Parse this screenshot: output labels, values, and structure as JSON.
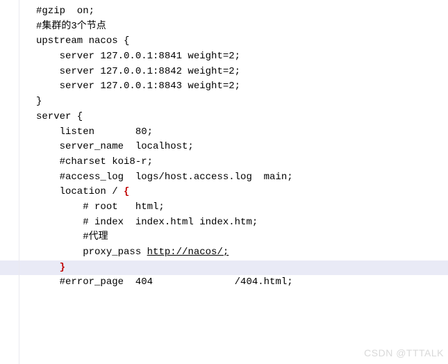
{
  "code": {
    "l1": "#gzip  on;",
    "l2": "",
    "l3": "#集群的3个节点",
    "l4": "upstream nacos {",
    "l5": "    server 127.0.0.1:8841 weight=2;",
    "l6": "    server 127.0.0.1:8842 weight=2;",
    "l7": "    server 127.0.0.1:8843 weight=2;",
    "l8": "}",
    "l9": "",
    "l10": "server {",
    "l11": "    listen       80;",
    "l12": "    server_name  localhost;",
    "l13": "",
    "l14": "    #charset koi8-r;",
    "l15": "",
    "l16": "    #access_log  logs/host.access.log  main;",
    "l17": "",
    "l18a": "    location / ",
    "l18b": "{",
    "l19": "        # root   html;",
    "l20": "        # index  index.html index.htm;",
    "l21": "        #代理",
    "l22a": "        proxy_pass ",
    "l22b": "http://nacos/;",
    "l23a": "    ",
    "l23b": "}",
    "l24": "",
    "l25": "    #error_page  404              /404.html;"
  },
  "watermark": "CSDN @TTTALK"
}
